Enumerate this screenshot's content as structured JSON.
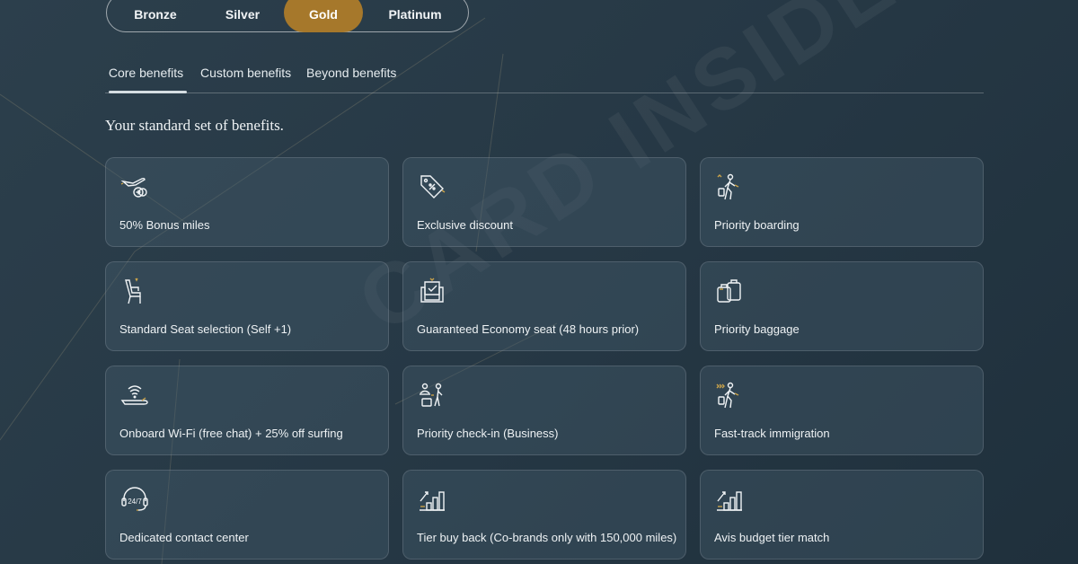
{
  "tiers": [
    "Bronze",
    "Silver",
    "Gold",
    "Platinum"
  ],
  "selected_tier": "Gold",
  "tabs": [
    "Core benefits",
    "Custom benefits",
    "Beyond benefits"
  ],
  "active_tab": "Core benefits",
  "subtitle": "Your standard set of benefits.",
  "watermark": "CARD INSIDER",
  "colors": {
    "accent": "#a6782b",
    "background": "#2a3c48",
    "icon_accent": "#c9a24a"
  },
  "benefits": [
    {
      "label": "50% Bonus miles",
      "icon": "plane-plus-icon"
    },
    {
      "label": "Exclusive discount",
      "icon": "discount-tag-icon"
    },
    {
      "label": "Priority boarding",
      "icon": "boarding-person-icon"
    },
    {
      "label": "Standard Seat selection (Self +1)",
      "icon": "seat-icon"
    },
    {
      "label": "Guaranteed Economy seat (48 hours prior)",
      "icon": "seat-check-icon"
    },
    {
      "label": "Priority baggage",
      "icon": "baggage-icon"
    },
    {
      "label": "Onboard Wi-Fi (free chat) + 25% off surfing",
      "icon": "wifi-plane-icon"
    },
    {
      "label": "Priority check-in (Business)",
      "icon": "check-in-icon"
    },
    {
      "label": "Fast-track immigration",
      "icon": "fast-track-icon"
    },
    {
      "label": "Dedicated contact center",
      "icon": "support-24-7-icon"
    },
    {
      "label": "Tier buy back (Co-brands only with 150,000 miles)",
      "icon": "tier-up-icon"
    },
    {
      "label": "Avis budget tier match",
      "icon": "tier-match-icon"
    }
  ]
}
